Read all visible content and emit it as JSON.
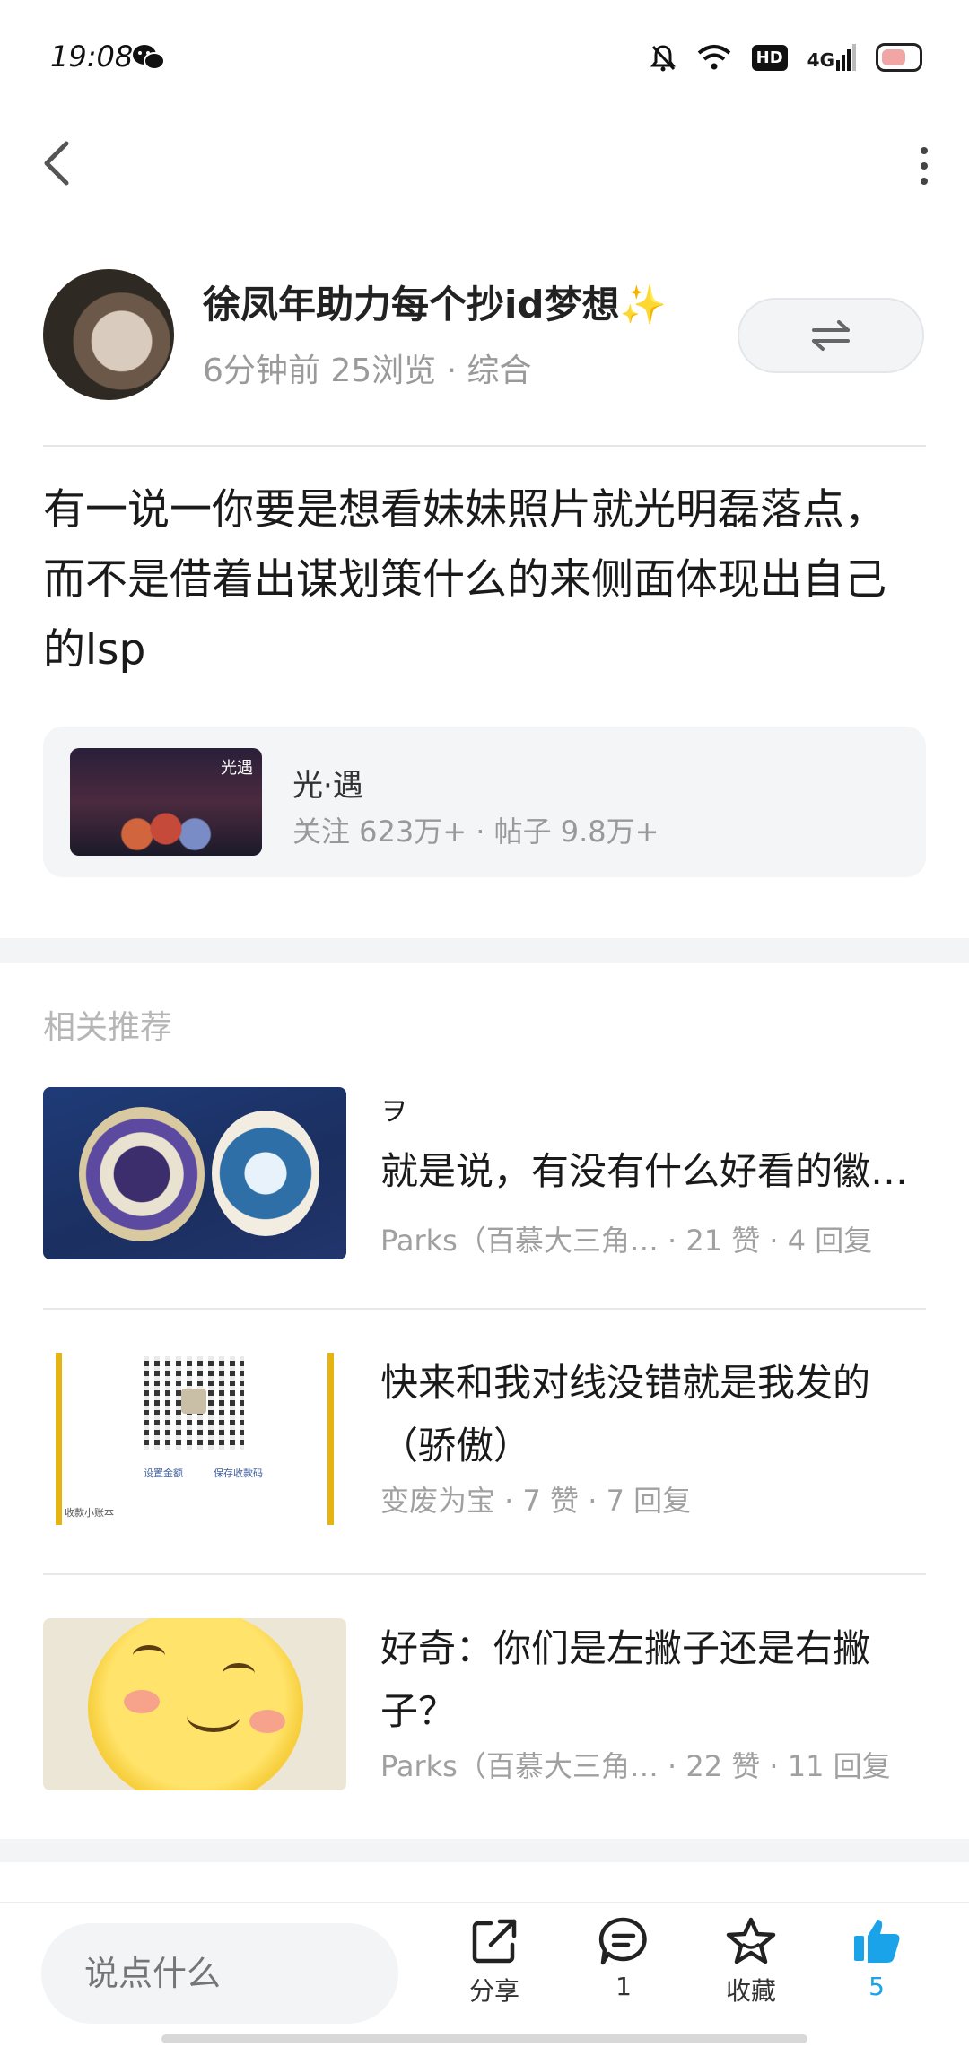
{
  "status_bar": {
    "time": "19:08",
    "network": "4G",
    "hd": "HD"
  },
  "author": {
    "name": "徐凤年助力每个抄id梦想✨",
    "meta": "6分钟前 25浏览 · 综合"
  },
  "post": {
    "text": "有一说一你要是想看妹妹照片就光明磊落点，而不是借着出谋划策什么的来侧面体现出自己的lsp"
  },
  "forum": {
    "name": "光·遇",
    "stats": "关注 623万+ · 帖子 9.8万+",
    "thumb_glyph": "光遇"
  },
  "related": {
    "title": "相关推荐",
    "items": [
      {
        "pre": "ヲ",
        "title": "就是说，有没有什么好看的徽…",
        "meta": "Parks（百慕大三角…   · 21 赞 · 4 回复"
      },
      {
        "title_line1": "快来和我对线没错就是我发的",
        "title_line2": "（骄傲）",
        "meta": "变废为宝 · 7 赞 · 7 回复",
        "qr_text_left": "设置金额",
        "qr_text_right": "保存收款码",
        "qr_foot": "收款小账本"
      },
      {
        "title_line1": "好奇：你们是左撇子还是右撇",
        "title_line2": "子？",
        "meta": "Parks（百慕大三角…  · 22 赞 · 11 回复"
      }
    ]
  },
  "bottom_bar": {
    "input_placeholder": "说点什么",
    "share_label": "分享",
    "comment_count": "1",
    "favorite_label": "收藏",
    "like_count": "5",
    "accent_color": "#1aa3e8"
  }
}
